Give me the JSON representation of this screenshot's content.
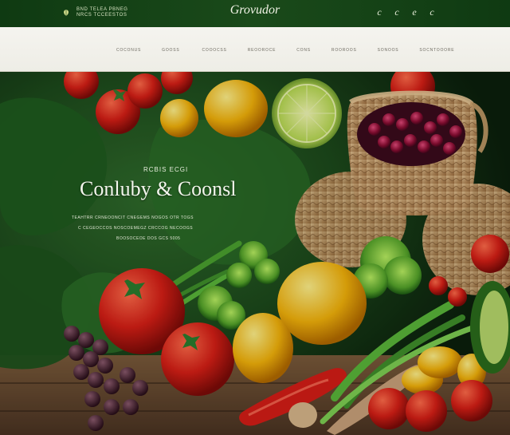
{
  "header": {
    "tagline": "BND TELEA PBNEG NRCS TCCEESTOS",
    "brand": "Grovudor",
    "right_icons": [
      "c",
      "c",
      "e",
      "c"
    ]
  },
  "nav": {
    "items": [
      "coconus",
      "gooss",
      "cooocss",
      "reooroce",
      "cons",
      "rooroos",
      "sonoos",
      "socntooore"
    ]
  },
  "hero": {
    "kicker": "RCBIS ECGI",
    "headline": "Conluby & Coonsl",
    "subtext_1": "TEAHTRR CRNEOONCIT CNEGEMS NOGOS OTR TOGS",
    "subtext_2": "C CEGEOCCOS   NOSCOEMEGZ   CRCCOG   NECOOGS",
    "subtext_3": "BOOSOCEOE DOS GCS 5005"
  },
  "colors": {
    "header_bg": "#123d14",
    "nav_bg": "#f2f1ea",
    "hero_text": "#f4f6ee"
  }
}
